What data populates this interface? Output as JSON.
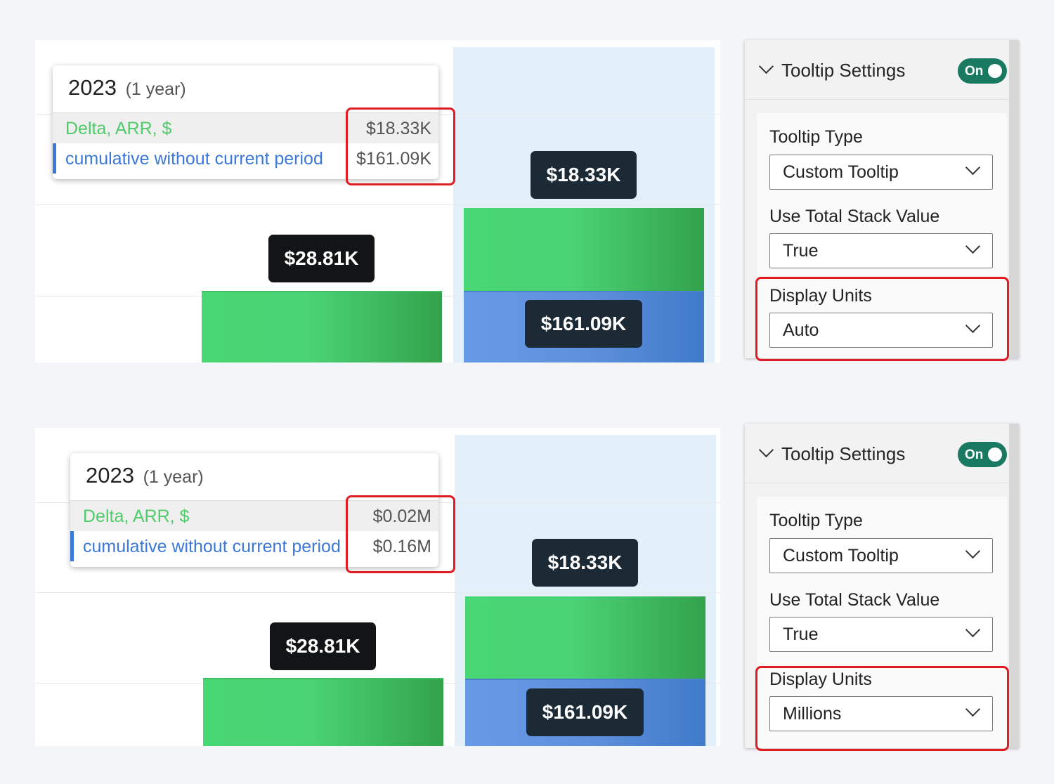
{
  "sections": [
    {
      "tooltip": {
        "year": "2023",
        "period": "(1 year)",
        "rows": [
          {
            "name": "Delta, ARR, $",
            "value": "$18.33K"
          },
          {
            "name": "cumulative without current period",
            "value": "$161.09K"
          }
        ]
      },
      "bar_labels": {
        "left": "$28.81K",
        "right_top": "$18.33K",
        "right_bottom": "$161.09K"
      },
      "panel": {
        "title": "Tooltip Settings",
        "toggle": "On",
        "tooltip_type_label": "Tooltip Type",
        "tooltip_type_value": "Custom Tooltip",
        "total_stack_label": "Use Total Stack Value",
        "total_stack_value": "True",
        "display_units_label": "Display Units",
        "display_units_value": "Auto"
      }
    },
    {
      "tooltip": {
        "year": "2023",
        "period": "(1 year)",
        "rows": [
          {
            "name": "Delta, ARR, $",
            "value": "$0.02M"
          },
          {
            "name": "cumulative without current period",
            "value": "$0.16M"
          }
        ]
      },
      "bar_labels": {
        "left": "$28.81K",
        "right_top": "$18.33K",
        "right_bottom": "$161.09K"
      },
      "panel": {
        "title": "Tooltip Settings",
        "toggle": "On",
        "tooltip_type_label": "Tooltip Type",
        "tooltip_type_value": "Custom Tooltip",
        "total_stack_label": "Use Total Stack Value",
        "total_stack_value": "True",
        "display_units_label": "Display Units",
        "display_units_value": "Millions"
      }
    }
  ],
  "colors": {
    "green": "#4ad375",
    "blue": "#5f90dd",
    "toggle_on": "#1a7a61",
    "highlight": "#e11b22"
  },
  "icons": {
    "collapse": "chevron-down-icon",
    "dropdown": "chevron-down-icon"
  }
}
